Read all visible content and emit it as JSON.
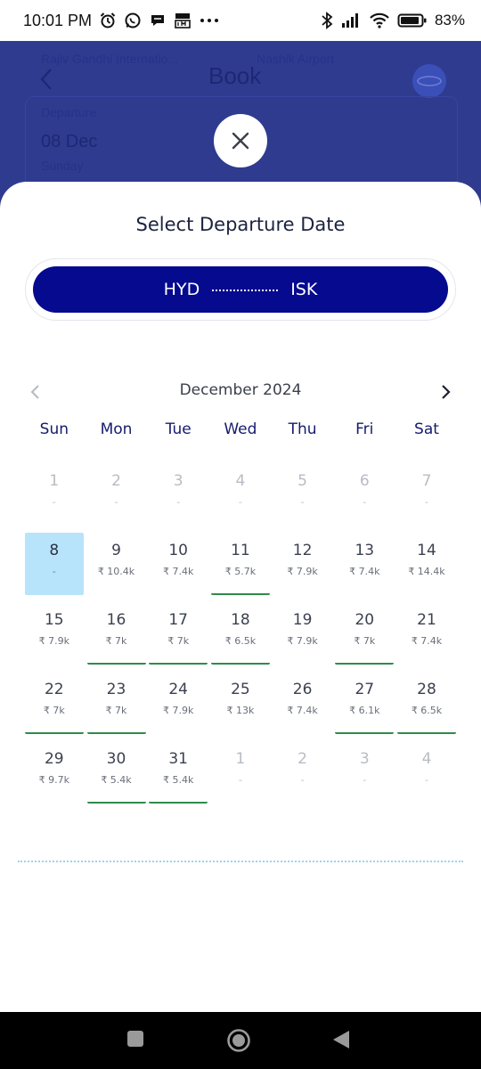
{
  "status_bar": {
    "time": "10:01 PM",
    "battery": "83%",
    "icons": [
      "alarm-icon",
      "whatsapp-icon",
      "chat-icon",
      "tata-1mg-icon",
      "more-dots-icon",
      "bluetooth-icon",
      "signal-icon",
      "wifi-icon",
      "battery-icon"
    ]
  },
  "background": {
    "title": "Book",
    "from_airport": "Rajiv Gandhi Internatio...",
    "to_airport": "Nashik Airport",
    "departure_label": "Departure",
    "departure_date": "08 Dec",
    "departure_day": "Sunday"
  },
  "sheet": {
    "title": "Select Departure Date",
    "route": {
      "from": "HYD",
      "to": "ISK"
    },
    "month": "December 2024",
    "weekdays": [
      "Sun",
      "Mon",
      "Tue",
      "Wed",
      "Thu",
      "Fri",
      "Sat"
    ],
    "weeks": [
      [
        {
          "day": "1",
          "price": "-",
          "muted": true
        },
        {
          "day": "2",
          "price": "-",
          "muted": true
        },
        {
          "day": "3",
          "price": "-",
          "muted": true
        },
        {
          "day": "4",
          "price": "-",
          "muted": true
        },
        {
          "day": "5",
          "price": "-",
          "muted": true
        },
        {
          "day": "6",
          "price": "-",
          "muted": true
        },
        {
          "day": "7",
          "price": "-",
          "muted": true
        }
      ],
      [
        {
          "day": "8",
          "price": "-",
          "selected": true
        },
        {
          "day": "9",
          "price": "₹ 10.4k"
        },
        {
          "day": "10",
          "price": "₹ 7.4k"
        },
        {
          "day": "11",
          "price": "₹ 5.7k",
          "cheap": true
        },
        {
          "day": "12",
          "price": "₹ 7.9k"
        },
        {
          "day": "13",
          "price": "₹ 7.4k"
        },
        {
          "day": "14",
          "price": "₹ 14.4k"
        }
      ],
      [
        {
          "day": "15",
          "price": "₹ 7.9k"
        },
        {
          "day": "16",
          "price": "₹ 7k",
          "cheap": true
        },
        {
          "day": "17",
          "price": "₹ 7k",
          "cheap": true
        },
        {
          "day": "18",
          "price": "₹ 6.5k",
          "cheap": true
        },
        {
          "day": "19",
          "price": "₹ 7.9k"
        },
        {
          "day": "20",
          "price": "₹ 7k",
          "cheap": true
        },
        {
          "day": "21",
          "price": "₹ 7.4k"
        }
      ],
      [
        {
          "day": "22",
          "price": "₹ 7k",
          "cheap": true
        },
        {
          "day": "23",
          "price": "₹ 7k",
          "cheap": true
        },
        {
          "day": "24",
          "price": "₹ 7.9k"
        },
        {
          "day": "25",
          "price": "₹ 13k"
        },
        {
          "day": "26",
          "price": "₹ 7.4k"
        },
        {
          "day": "27",
          "price": "₹ 6.1k",
          "cheap": true
        },
        {
          "day": "28",
          "price": "₹ 6.5k",
          "cheap": true
        }
      ],
      [
        {
          "day": "29",
          "price": "₹ 9.7k"
        },
        {
          "day": "30",
          "price": "₹ 5.4k",
          "cheap": true
        },
        {
          "day": "31",
          "price": "₹ 5.4k",
          "cheap": true
        },
        {
          "day": "1",
          "price": "-",
          "muted": true
        },
        {
          "day": "2",
          "price": "-",
          "muted": true
        },
        {
          "day": "3",
          "price": "-",
          "muted": true
        },
        {
          "day": "4",
          "price": "-",
          "muted": true
        }
      ]
    ]
  },
  "colors": {
    "primary": "#050a8f",
    "selected_bg": "#b8e4fb",
    "cheap_underline": "#2e8b4a",
    "overlay": "#2f3b8f"
  }
}
